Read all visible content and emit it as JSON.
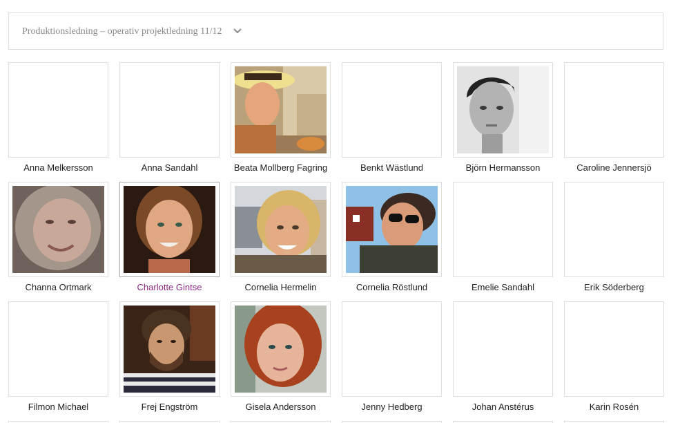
{
  "selector": {
    "label": "Produktionsledning – operativ projektledning 11/12",
    "icon": "chevron-down-icon"
  },
  "people": [
    {
      "name": "Anna Melkersson",
      "photo": "none"
    },
    {
      "name": "Anna Sandahl",
      "photo": "none"
    },
    {
      "name": "Beata Mollberg Fagring",
      "photo": "beata"
    },
    {
      "name": "Benkt Wästlund",
      "photo": "none"
    },
    {
      "name": "Björn Hermansson",
      "photo": "bjorn"
    },
    {
      "name": "Caroline Jennersjö",
      "photo": "none"
    },
    {
      "name": "Channa Ortmark",
      "photo": "channa"
    },
    {
      "name": "Charlotte Gintse",
      "photo": "charlotte",
      "active": true
    },
    {
      "name": "Cornelia Hermelin",
      "photo": "cornelia-h"
    },
    {
      "name": "Cornelia Röstlund",
      "photo": "cornelia-r"
    },
    {
      "name": "Emelie Sandahl",
      "photo": "none"
    },
    {
      "name": "Erik Söderberg",
      "photo": "none"
    },
    {
      "name": "Filmon Michael",
      "photo": "none"
    },
    {
      "name": "Frej Engström",
      "photo": "frej"
    },
    {
      "name": "Gisela Andersson",
      "photo": "gisela"
    },
    {
      "name": "Jenny Hedberg",
      "photo": "none"
    },
    {
      "name": "Johan Anstérus",
      "photo": "none"
    },
    {
      "name": "Karin Rosén",
      "photo": "none"
    }
  ],
  "colors": {
    "active_name": "#8b2a87",
    "selector_text": "#8a8a8a",
    "border": "#dedede"
  }
}
